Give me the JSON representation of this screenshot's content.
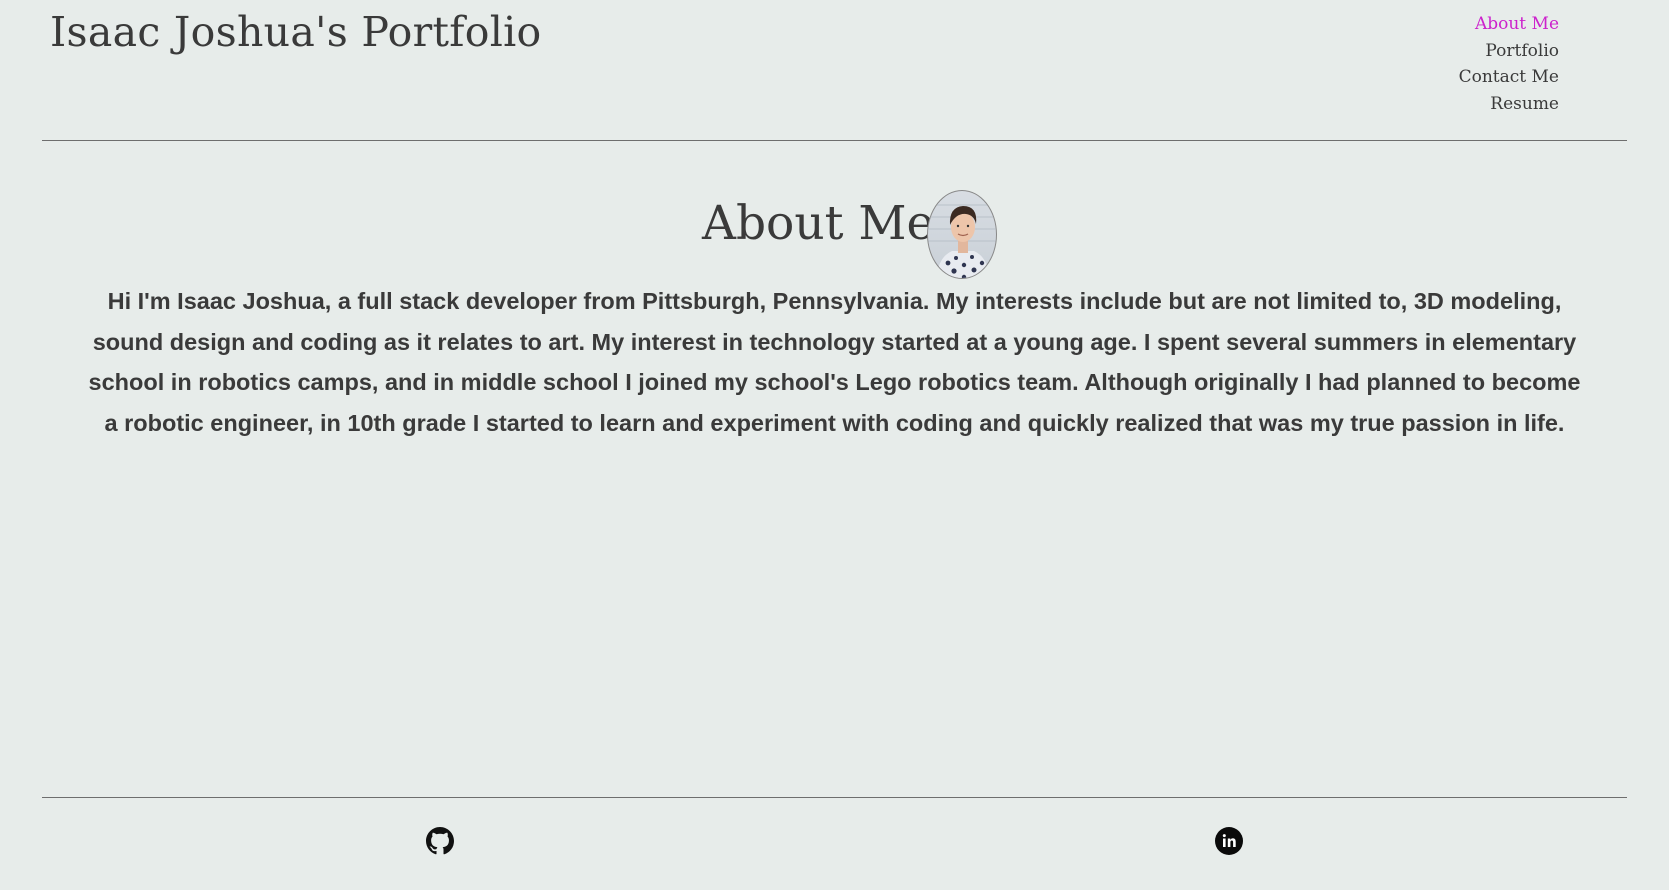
{
  "header": {
    "site_title": "Isaac Joshua's Portfolio"
  },
  "nav": {
    "items": [
      {
        "label": "About Me",
        "active": true
      },
      {
        "label": "Portfolio",
        "active": false
      },
      {
        "label": "Contact Me",
        "active": false
      },
      {
        "label": "Resume",
        "active": false
      }
    ]
  },
  "about": {
    "heading": "About Me",
    "bio": "Hi I'm Isaac Joshua, a full stack developer from Pittsburgh, Pennsylvania. My interests include but are not limited to, 3D modeling, sound design and coding as it relates to art. My interest in technology started at a young age. I spent several summers in elementary school in robotics camps, and in middle school I joined my school's Lego robotics team. Although originally I had planned to become a robotic engineer, in 10th grade I started to learn and experiment with coding and quickly realized that was my true passion in life."
  },
  "footer": {
    "links": [
      {
        "icon": "github-icon"
      },
      {
        "icon": "linkedin-icon"
      }
    ]
  },
  "colors": {
    "background": "#e7ecea",
    "text": "#3a3a3a",
    "nav_active": "#cc22cc",
    "rule": "#6e6e6e"
  }
}
